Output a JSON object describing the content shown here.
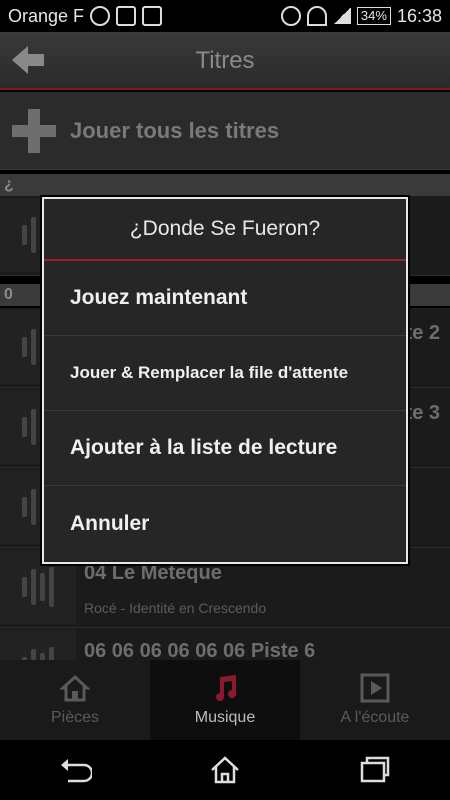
{
  "status_bar": {
    "carrier": "Orange F",
    "battery": "34%",
    "time": "16:38"
  },
  "appbar": {
    "title": "Titres"
  },
  "play_all": {
    "label": "Jouer tous les titres"
  },
  "sections": [
    {
      "letter": "¿"
    },
    {
      "letter": "0"
    }
  ],
  "list": {
    "peek_1": "te 2",
    "peek_2": "te 3",
    "track_title": "04 Le Meteque",
    "track_sub": "Rocé - Identité en Crescendo",
    "track_title_2": "06 06 06 06 06 06 Piste 6"
  },
  "dialog": {
    "title": "¿Donde Se Fueron?",
    "options": [
      "Jouez maintenant",
      "Jouer & Remplacer la file d'attente",
      "Ajouter à la liste de lecture",
      "Annuler"
    ]
  },
  "tabs": [
    {
      "label": "Pièces",
      "icon": "home-icon"
    },
    {
      "label": "Musique",
      "icon": "music-note-icon",
      "active": true
    },
    {
      "label": "A l'écoute",
      "icon": "play-icon"
    }
  ],
  "colors": {
    "accent": "#9a1d33",
    "music_icon": "#8b1a2c"
  }
}
